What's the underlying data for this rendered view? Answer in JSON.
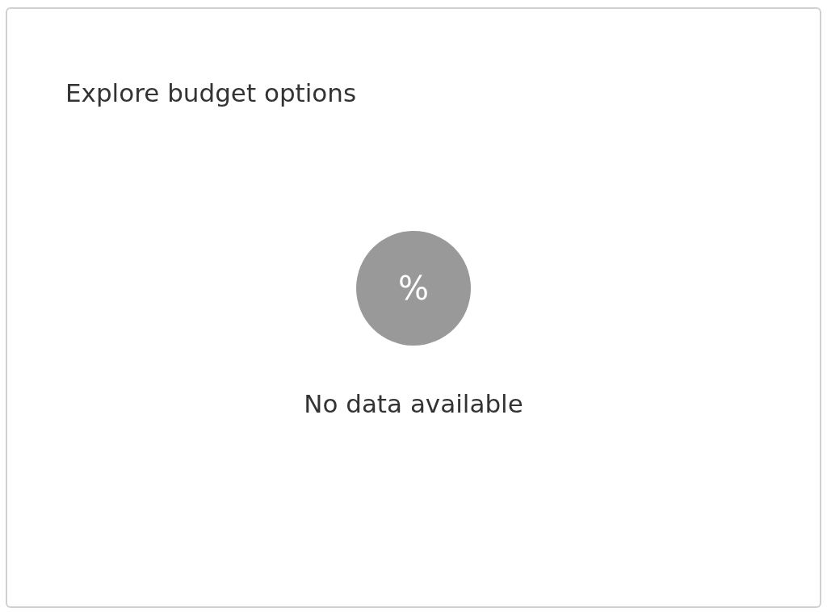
{
  "card": {
    "title": "Explore budget options",
    "empty_state": {
      "icon_text": "%",
      "message": "No data available"
    }
  }
}
